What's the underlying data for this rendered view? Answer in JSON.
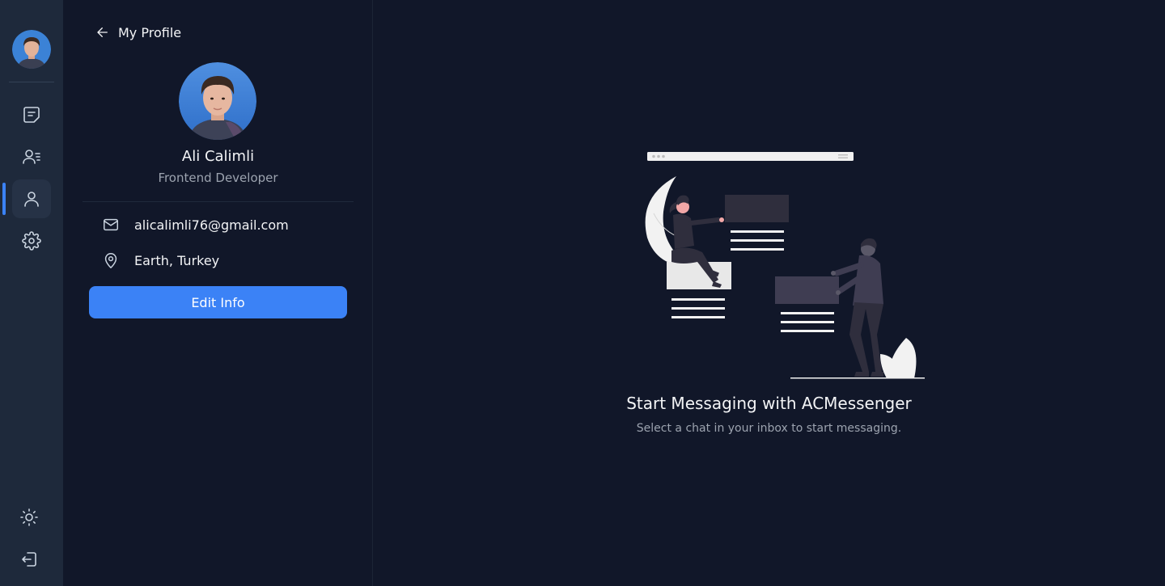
{
  "rail": {
    "items": [
      {
        "name": "chats",
        "icon": "chat-icon"
      },
      {
        "name": "contacts",
        "icon": "contacts-icon"
      },
      {
        "name": "profile",
        "icon": "user-icon",
        "active": true
      },
      {
        "name": "settings",
        "icon": "gear-icon"
      }
    ],
    "bottom": [
      {
        "name": "theme",
        "icon": "sun-icon"
      },
      {
        "name": "logout",
        "icon": "logout-icon"
      }
    ]
  },
  "profile": {
    "header_title": "My Profile",
    "name": "Ali Calimli",
    "role": "Frontend Developer",
    "email": "alicalimli76@gmail.com",
    "location": "Earth, Turkey",
    "edit_label": "Edit Info"
  },
  "main": {
    "empty_title": "Start Messaging with ACMessenger",
    "empty_subtitle": "Select a chat in your inbox to start messaging."
  },
  "colors": {
    "background": "#111729",
    "rail": "#1e293b",
    "accent": "#3b82f6",
    "muted_text": "#9ca3af"
  }
}
